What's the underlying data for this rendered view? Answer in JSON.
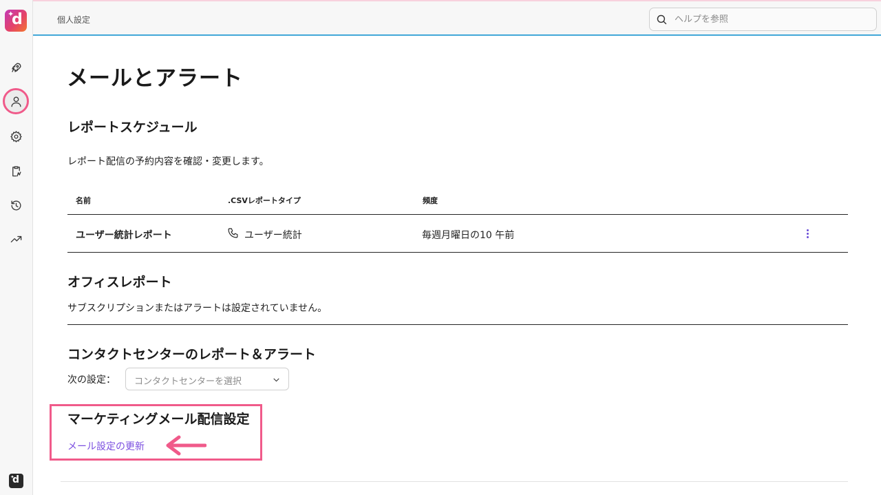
{
  "topbar": {
    "breadcrumb": "個人設定",
    "search_placeholder": "ヘルプを参照"
  },
  "sidebar": {
    "items": [
      {
        "icon": "rocket-icon",
        "active": false
      },
      {
        "icon": "user-icon",
        "active": true
      },
      {
        "icon": "gear-icon",
        "active": false
      },
      {
        "icon": "clipboard-icon",
        "active": false
      },
      {
        "icon": "history-icon",
        "active": false
      },
      {
        "icon": "trending-up-icon",
        "active": false
      }
    ]
  },
  "page": {
    "title": "メールとアラート"
  },
  "report_schedule": {
    "heading": "レポートスケジュール",
    "description": "レポート配信の予約内容を確認・変更します。",
    "columns": [
      "名前",
      ".CSVレポートタイプ",
      "頻度"
    ],
    "rows": [
      {
        "name": "ユーザー統計レポート",
        "type": "ユーザー統計",
        "type_icon": "phone-icon",
        "frequency": "毎週月曜日の10 午前"
      }
    ]
  },
  "office_report": {
    "heading": "オフィスレポート",
    "message": "サブスクリプションまたはアラートは設定されていません。"
  },
  "contact_center": {
    "heading": "コンタクトセンターのレポート＆アラート",
    "label": "次の設定：",
    "select_placeholder": "コンタクトセンターを選択"
  },
  "marketing": {
    "heading": "マーケティングメール配信設定",
    "link": "メール設定の更新"
  },
  "colors": {
    "accent": "#7b4fe0",
    "highlight": "#f05a8a",
    "topbar_border": "#41a7d8"
  }
}
